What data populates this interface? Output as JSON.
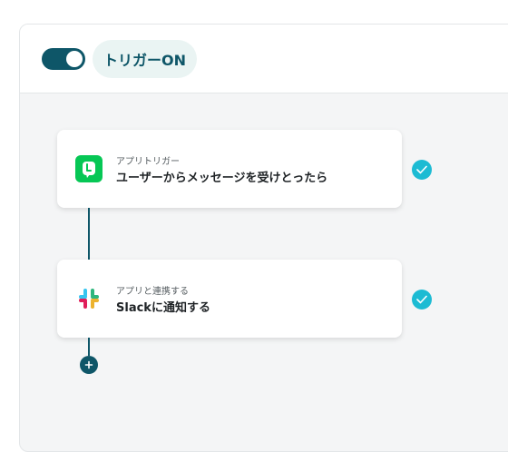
{
  "header": {
    "toggle_state": "on",
    "trigger_label": "トリガーON"
  },
  "flow": {
    "steps": [
      {
        "subtitle": "アプリトリガー",
        "title": "ユーザーからメッセージを受けとったら",
        "icon": "line-app-icon",
        "status": "complete"
      },
      {
        "subtitle": "アプリと連携する",
        "title": "Slackに通知する",
        "icon": "slack-app-icon",
        "status": "complete"
      }
    ],
    "add_step_icon": "plus-icon"
  },
  "colors": {
    "accent": "#0e5668",
    "check": "#1cbbd3",
    "line_green": "#06c755",
    "pill_bg": "#eaf4f3"
  }
}
